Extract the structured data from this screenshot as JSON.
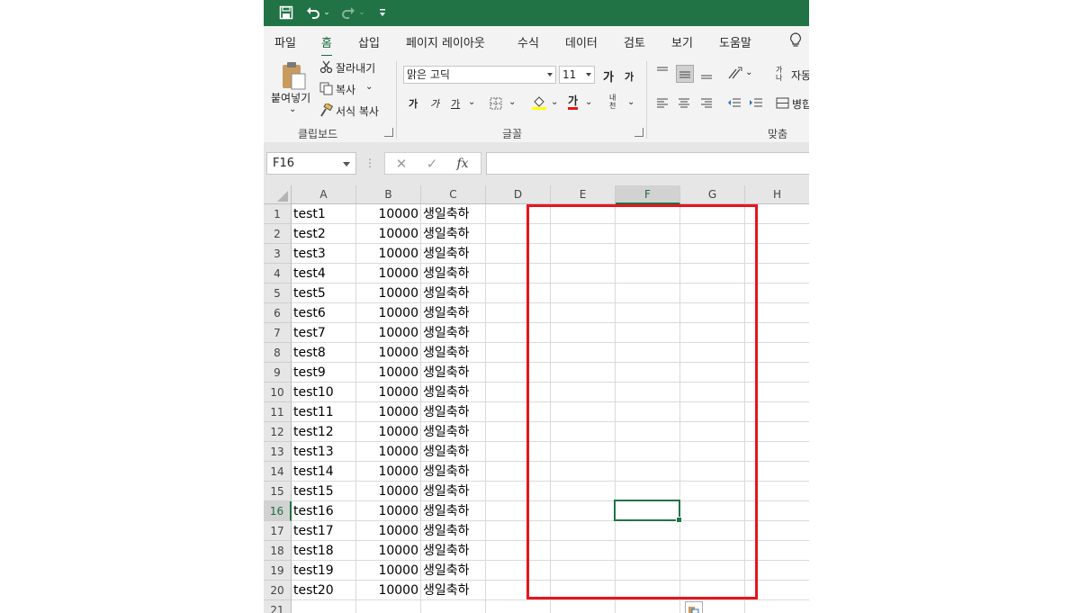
{
  "colors": {
    "accent": "#217346",
    "highlight": "#e8141b",
    "ribbon_bg": "#f3f3f3"
  },
  "qat": {
    "icons": [
      "save-icon",
      "undo-icon",
      "redo-icon",
      "customize-icon"
    ]
  },
  "tabs": [
    "파일",
    "홈",
    "삽입",
    "페이지 레이아웃",
    "수식",
    "데이터",
    "검토",
    "보기",
    "도움말"
  ],
  "active_tab": "홈",
  "ribbon": {
    "clipboard": {
      "paste": "붙여넣기",
      "cut": "잘라내기",
      "copy": "복사",
      "format_painter": "서식 복사",
      "group_label": "클립보드"
    },
    "font": {
      "font_name": "맑은 고딕",
      "font_size": "11",
      "grow": "가",
      "shrink": "가",
      "bold": "가",
      "italic": "가",
      "underline": "가",
      "font_color": "가",
      "phonetic": "내천",
      "group_label": "글꼴"
    },
    "alignment": {
      "wrap_label": "자동",
      "merge_label": "병합",
      "group_label": "맞춤"
    }
  },
  "formula_bar": {
    "name_box": "F16",
    "formula": ""
  },
  "columns": [
    "A",
    "B",
    "C",
    "D",
    "E",
    "F",
    "G",
    "H"
  ],
  "selected_column": "F",
  "selected_row": 16,
  "rows": [
    {
      "n": "1",
      "a": "test1",
      "b": "10000",
      "c": "생일축하"
    },
    {
      "n": "2",
      "a": "test2",
      "b": "10000",
      "c": "생일축하"
    },
    {
      "n": "3",
      "a": "test3",
      "b": "10000",
      "c": "생일축하"
    },
    {
      "n": "4",
      "a": "test4",
      "b": "10000",
      "c": "생일축하"
    },
    {
      "n": "5",
      "a": "test5",
      "b": "10000",
      "c": "생일축하"
    },
    {
      "n": "6",
      "a": "test6",
      "b": "10000",
      "c": "생일축하"
    },
    {
      "n": "7",
      "a": "test7",
      "b": "10000",
      "c": "생일축하"
    },
    {
      "n": "8",
      "a": "test8",
      "b": "10000",
      "c": "생일축하"
    },
    {
      "n": "9",
      "a": "test9",
      "b": "10000",
      "c": "생일축하"
    },
    {
      "n": "10",
      "a": "test10",
      "b": "10000",
      "c": "생일축하"
    },
    {
      "n": "11",
      "a": "test11",
      "b": "10000",
      "c": "생일축하"
    },
    {
      "n": "12",
      "a": "test12",
      "b": "10000",
      "c": "생일축하"
    },
    {
      "n": "13",
      "a": "test13",
      "b": "10000",
      "c": "생일축하"
    },
    {
      "n": "14",
      "a": "test14",
      "b": "10000",
      "c": "생일축하"
    },
    {
      "n": "15",
      "a": "test15",
      "b": "10000",
      "c": "생일축하"
    },
    {
      "n": "16",
      "a": "test16",
      "b": "10000",
      "c": "생일축하"
    },
    {
      "n": "17",
      "a": "test17",
      "b": "10000",
      "c": "생일축하"
    },
    {
      "n": "18",
      "a": "test18",
      "b": "10000",
      "c": "생일축하"
    },
    {
      "n": "19",
      "a": "test19",
      "b": "10000",
      "c": "생일축하"
    },
    {
      "n": "20",
      "a": "test20",
      "b": "10000",
      "c": "생일축하"
    },
    {
      "n": "21",
      "a": "",
      "b": "",
      "c": ""
    }
  ]
}
